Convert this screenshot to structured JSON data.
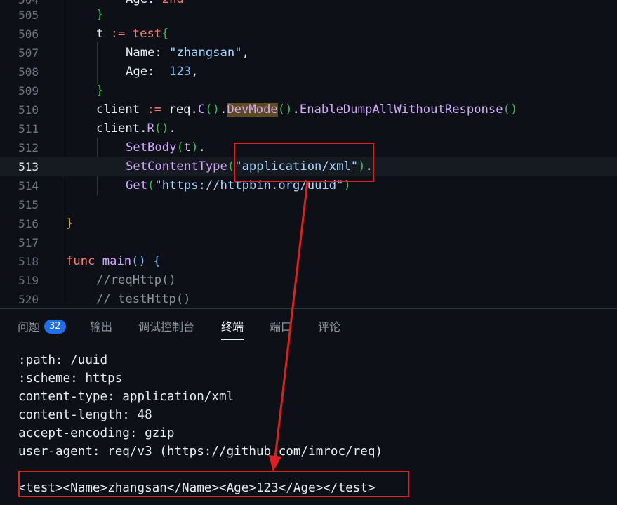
{
  "editor": {
    "lines": [
      {
        "num": "504",
        "partial": true
      },
      {
        "num": "505"
      },
      {
        "num": "506"
      },
      {
        "num": "507"
      },
      {
        "num": "508"
      },
      {
        "num": "509"
      },
      {
        "num": "510"
      },
      {
        "num": "511"
      },
      {
        "num": "512"
      },
      {
        "num": "513",
        "active": true
      },
      {
        "num": "514"
      },
      {
        "num": "515"
      },
      {
        "num": "516"
      },
      {
        "num": "517"
      },
      {
        "num": "518"
      },
      {
        "num": "519"
      },
      {
        "num": "520"
      }
    ],
    "tokens": {
      "l504_a": "Age: ",
      "l504_b": "2nd",
      "l505": "}",
      "l506_var": "t ",
      "l506_op": ":= ",
      "l506_fn": "test",
      "l506_br": "{",
      "l507_key": "Name: ",
      "l507_str": "\"zhangsan\"",
      "l507_c": ",",
      "l508_key": "Age:  ",
      "l508_num": "123",
      "l508_c": ",",
      "l509": "}",
      "l510_a": "client ",
      "l510_op": ":= ",
      "l510_b": "req.",
      "l510_c": "C",
      "l510_p1": "(",
      "l510_p2": ")",
      "l510_d": ".",
      "l510_dev": "DevMode",
      "l510_p3": "(",
      "l510_p4": ")",
      "l510_e": ".",
      "l510_en": "EnableDumpAllWithoutResponse",
      "l510_p5": "(",
      "l510_p6": ")",
      "l511_a": "client.",
      "l511_r": "R",
      "l511_p1": "(",
      "l511_p2": ")",
      "l511_b": ".",
      "l512_fn": "SetBody",
      "l512_p1": "(",
      "l512_t": "t",
      "l512_p2": ")",
      "l512_d": ".",
      "l513_fn": "SetContentType",
      "l513_p1": "(",
      "l513_str": "\"application/xml\"",
      "l513_p2": ")",
      "l513_d": ".",
      "l514_fn": "Get",
      "l514_p1": "(",
      "l514_q1": "\"",
      "l514_url": "https://httpbin.org/uuid",
      "l514_q2": "\"",
      "l514_p2": ")",
      "l516": "}",
      "l518_kw": "func ",
      "l518_fn": "main",
      "l518_p": "() ",
      "l518_br": "{",
      "l519": "//reqHttp()",
      "l520": "// testHttp()"
    }
  },
  "panel": {
    "tabs": [
      {
        "label": "问题",
        "badge": "32"
      },
      {
        "label": "输出"
      },
      {
        "label": "调试控制台"
      },
      {
        "label": "终端",
        "active": true
      },
      {
        "label": "端口"
      },
      {
        "label": "评论"
      }
    ]
  },
  "terminal": {
    "lines": [
      ":path: /uuid",
      ":scheme: https",
      "content-type: application/xml",
      "content-length: 48",
      "accept-encoding: gzip",
      "user-agent: req/v3 (https://github.com/imroc/req)",
      "",
      "<test><Name>zhangsan</Name><Age>123</Age></test>"
    ]
  },
  "annotations": {
    "color": "#e02020"
  }
}
